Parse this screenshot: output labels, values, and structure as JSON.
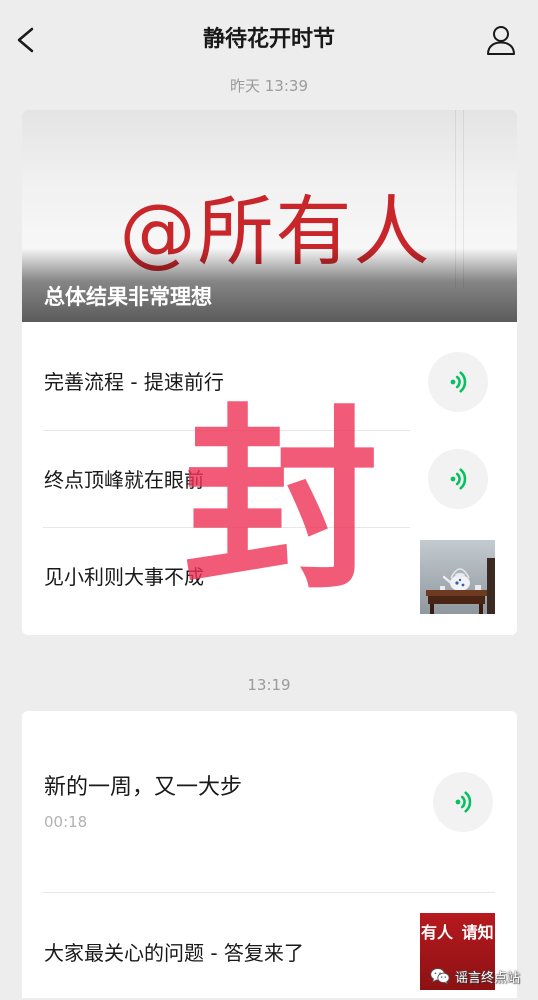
{
  "header": {
    "back_icon": "chevron-left-icon",
    "title": "静待花开时节",
    "profile_icon": "person-icon"
  },
  "groups": [
    {
      "timestamp": "昨天 13:39",
      "cover": {
        "image_text": "@所有人",
        "title": "总体结果非常理想"
      },
      "items": [
        {
          "title": "完善流程 - 提速前行",
          "icon": "voice-icon"
        },
        {
          "title": "终点顶峰就在眼前",
          "icon": "voice-icon"
        },
        {
          "title": "见小利则大事不成"
        }
      ]
    },
    {
      "timestamp": "13:19",
      "items": [
        {
          "title": "新的一周，又一大步",
          "duration": "00:18",
          "icon": "voice-icon"
        },
        {
          "title": "大家最关心的问题 - 答复来了",
          "thumbnail_text": "有人 请知"
        }
      ]
    }
  ],
  "overlay_stamp": "封",
  "watermark": {
    "icon": "wechat-icon",
    "text": "谣言终点站"
  },
  "colors": {
    "background": "#ededed",
    "card": "#ffffff",
    "voice_green": "#07c160",
    "stamp": "#f15b77",
    "cover_text": "#c8262a",
    "thumbnail_red": "#b0181c"
  }
}
